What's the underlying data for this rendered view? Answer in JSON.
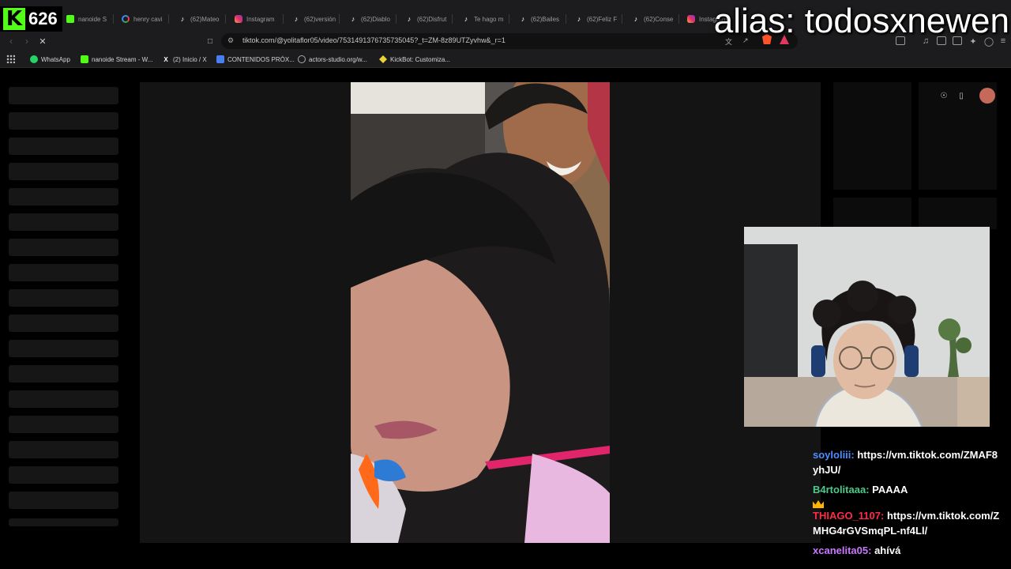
{
  "tabs": [
    {
      "label": "nanoide S",
      "icon": "kick-icon"
    },
    {
      "label": "henry cavi",
      "icon": "google-icon"
    },
    {
      "label": "(62)Mateo",
      "icon": "tiktok-icon"
    },
    {
      "label": "Instagram",
      "icon": "instagram-icon"
    },
    {
      "label": "(62)versión",
      "icon": "tiktok-icon"
    },
    {
      "label": "(62)Diablo",
      "icon": "tiktok-icon"
    },
    {
      "label": "(62)Disfrut",
      "icon": "tiktok-icon"
    },
    {
      "label": "Te hago m",
      "icon": "tiktok-icon"
    },
    {
      "label": "(62)Bailes",
      "icon": "tiktok-icon"
    },
    {
      "label": "(62)Feliz F",
      "icon": "tiktok-icon"
    },
    {
      "label": "(62)Conse",
      "icon": "tiktok-icon"
    },
    {
      "label": "Instagram",
      "icon": "instagram-icon"
    }
  ],
  "address_bar": {
    "url": "tiktok.com/@yolitaflor05/video/7531491376735735045?_t=ZM-8z89UTZyvhw&_r=1"
  },
  "bookmarks": [
    {
      "label": "WhatsApp",
      "icon": "whatsapp-icon"
    },
    {
      "label": "nanoide Stream - W...",
      "icon": "kick-icon"
    },
    {
      "label": "(2) Inicio / X",
      "icon": "x-icon"
    },
    {
      "label": "CONTENIDOS PRÓX...",
      "icon": "docs-icon"
    },
    {
      "label": "actors-studio.org/w...",
      "icon": "globe-icon"
    },
    {
      "label": "KickBot: Customiza...",
      "icon": "kickbot-icon"
    }
  ],
  "stream_overlay": {
    "viewer_count": "626",
    "alias_text": "alias: todosxnewen",
    "brand_color": "#53fc18"
  },
  "chat": [
    {
      "user": "soyloliii:",
      "text": "https://vm.tiktok.com/ZMAF8yhJU/",
      "color": "#4f8dff",
      "badge": ""
    },
    {
      "user": "B4rtolitaaa:",
      "text": "PAAAA",
      "color": "#4ec98b",
      "badge": ""
    },
    {
      "user": "THIAGO_1107:",
      "text": "https://vm.tiktok.com/ZMHG4rGVSmqPL-nf4Ll/",
      "color": "#ff2b47",
      "badge": "crown-icon"
    },
    {
      "user": "xcanelita05:",
      "text": "ahívá",
      "color": "#c879ff",
      "badge": ""
    }
  ]
}
